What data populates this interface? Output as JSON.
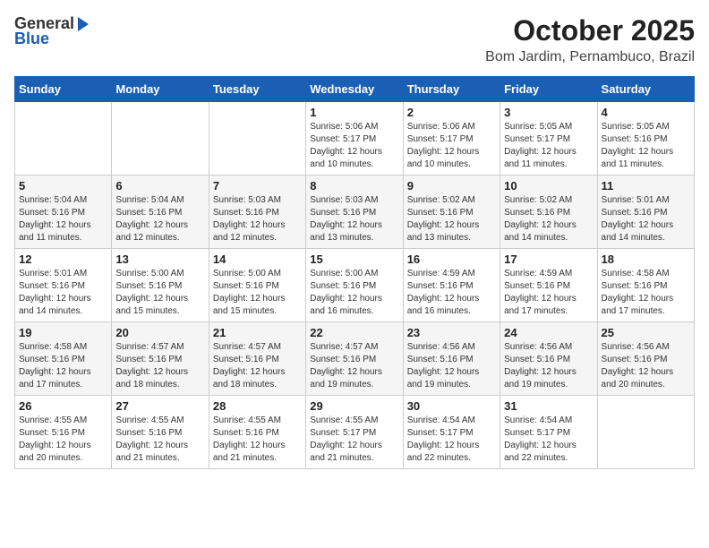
{
  "header": {
    "logo_general": "General",
    "logo_blue": "Blue",
    "month": "October 2025",
    "location": "Bom Jardim, Pernambuco, Brazil"
  },
  "days_of_week": [
    "Sunday",
    "Monday",
    "Tuesday",
    "Wednesday",
    "Thursday",
    "Friday",
    "Saturday"
  ],
  "weeks": [
    [
      {
        "day": "",
        "info": ""
      },
      {
        "day": "",
        "info": ""
      },
      {
        "day": "",
        "info": ""
      },
      {
        "day": "1",
        "info": "Sunrise: 5:06 AM\nSunset: 5:17 PM\nDaylight: 12 hours\nand 10 minutes."
      },
      {
        "day": "2",
        "info": "Sunrise: 5:06 AM\nSunset: 5:17 PM\nDaylight: 12 hours\nand 10 minutes."
      },
      {
        "day": "3",
        "info": "Sunrise: 5:05 AM\nSunset: 5:17 PM\nDaylight: 12 hours\nand 11 minutes."
      },
      {
        "day": "4",
        "info": "Sunrise: 5:05 AM\nSunset: 5:16 PM\nDaylight: 12 hours\nand 11 minutes."
      }
    ],
    [
      {
        "day": "5",
        "info": "Sunrise: 5:04 AM\nSunset: 5:16 PM\nDaylight: 12 hours\nand 11 minutes."
      },
      {
        "day": "6",
        "info": "Sunrise: 5:04 AM\nSunset: 5:16 PM\nDaylight: 12 hours\nand 12 minutes."
      },
      {
        "day": "7",
        "info": "Sunrise: 5:03 AM\nSunset: 5:16 PM\nDaylight: 12 hours\nand 12 minutes."
      },
      {
        "day": "8",
        "info": "Sunrise: 5:03 AM\nSunset: 5:16 PM\nDaylight: 12 hours\nand 13 minutes."
      },
      {
        "day": "9",
        "info": "Sunrise: 5:02 AM\nSunset: 5:16 PM\nDaylight: 12 hours\nand 13 minutes."
      },
      {
        "day": "10",
        "info": "Sunrise: 5:02 AM\nSunset: 5:16 PM\nDaylight: 12 hours\nand 14 minutes."
      },
      {
        "day": "11",
        "info": "Sunrise: 5:01 AM\nSunset: 5:16 PM\nDaylight: 12 hours\nand 14 minutes."
      }
    ],
    [
      {
        "day": "12",
        "info": "Sunrise: 5:01 AM\nSunset: 5:16 PM\nDaylight: 12 hours\nand 14 minutes."
      },
      {
        "day": "13",
        "info": "Sunrise: 5:00 AM\nSunset: 5:16 PM\nDaylight: 12 hours\nand 15 minutes."
      },
      {
        "day": "14",
        "info": "Sunrise: 5:00 AM\nSunset: 5:16 PM\nDaylight: 12 hours\nand 15 minutes."
      },
      {
        "day": "15",
        "info": "Sunrise: 5:00 AM\nSunset: 5:16 PM\nDaylight: 12 hours\nand 16 minutes."
      },
      {
        "day": "16",
        "info": "Sunrise: 4:59 AM\nSunset: 5:16 PM\nDaylight: 12 hours\nand 16 minutes."
      },
      {
        "day": "17",
        "info": "Sunrise: 4:59 AM\nSunset: 5:16 PM\nDaylight: 12 hours\nand 17 minutes."
      },
      {
        "day": "18",
        "info": "Sunrise: 4:58 AM\nSunset: 5:16 PM\nDaylight: 12 hours\nand 17 minutes."
      }
    ],
    [
      {
        "day": "19",
        "info": "Sunrise: 4:58 AM\nSunset: 5:16 PM\nDaylight: 12 hours\nand 17 minutes."
      },
      {
        "day": "20",
        "info": "Sunrise: 4:57 AM\nSunset: 5:16 PM\nDaylight: 12 hours\nand 18 minutes."
      },
      {
        "day": "21",
        "info": "Sunrise: 4:57 AM\nSunset: 5:16 PM\nDaylight: 12 hours\nand 18 minutes."
      },
      {
        "day": "22",
        "info": "Sunrise: 4:57 AM\nSunset: 5:16 PM\nDaylight: 12 hours\nand 19 minutes."
      },
      {
        "day": "23",
        "info": "Sunrise: 4:56 AM\nSunset: 5:16 PM\nDaylight: 12 hours\nand 19 minutes."
      },
      {
        "day": "24",
        "info": "Sunrise: 4:56 AM\nSunset: 5:16 PM\nDaylight: 12 hours\nand 19 minutes."
      },
      {
        "day": "25",
        "info": "Sunrise: 4:56 AM\nSunset: 5:16 PM\nDaylight: 12 hours\nand 20 minutes."
      }
    ],
    [
      {
        "day": "26",
        "info": "Sunrise: 4:55 AM\nSunset: 5:16 PM\nDaylight: 12 hours\nand 20 minutes."
      },
      {
        "day": "27",
        "info": "Sunrise: 4:55 AM\nSunset: 5:16 PM\nDaylight: 12 hours\nand 21 minutes."
      },
      {
        "day": "28",
        "info": "Sunrise: 4:55 AM\nSunset: 5:16 PM\nDaylight: 12 hours\nand 21 minutes."
      },
      {
        "day": "29",
        "info": "Sunrise: 4:55 AM\nSunset: 5:17 PM\nDaylight: 12 hours\nand 21 minutes."
      },
      {
        "day": "30",
        "info": "Sunrise: 4:54 AM\nSunset: 5:17 PM\nDaylight: 12 hours\nand 22 minutes."
      },
      {
        "day": "31",
        "info": "Sunrise: 4:54 AM\nSunset: 5:17 PM\nDaylight: 12 hours\nand 22 minutes."
      },
      {
        "day": "",
        "info": ""
      }
    ]
  ]
}
